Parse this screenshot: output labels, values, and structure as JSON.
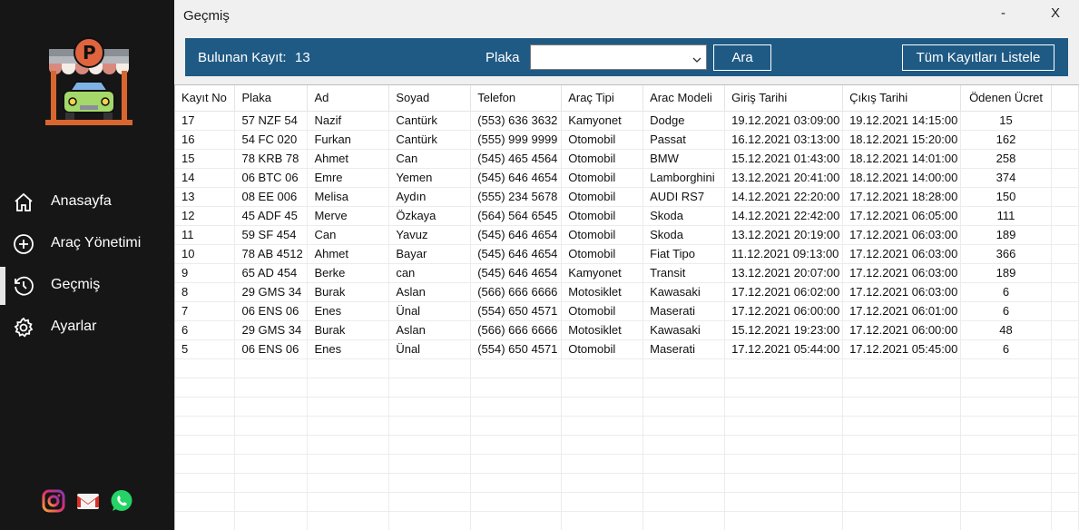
{
  "window": {
    "title": "Geçmiş",
    "minimize_label": "-",
    "close_label": "X"
  },
  "sidebar": {
    "items": [
      {
        "label": "Anasayfa",
        "icon": "home-icon",
        "active": false
      },
      {
        "label": "Araç Yönetimi",
        "icon": "plus-circle-icon",
        "active": false
      },
      {
        "label": "Geçmiş",
        "icon": "history-icon",
        "active": true
      },
      {
        "label": "Ayarlar",
        "icon": "gear-icon",
        "active": false
      }
    ],
    "social": [
      "instagram-icon",
      "gmail-icon",
      "whatsapp-icon"
    ]
  },
  "toolbar": {
    "found_label": "Bulunan Kayıt:",
    "found_value": "13",
    "plaka_label": "Plaka",
    "plaka_value": "",
    "search_label": "Ara",
    "list_all_label": "Tüm Kayıtları Listele"
  },
  "table": {
    "columns": [
      "Kayıt No",
      "Plaka",
      "Ad",
      "Soyad",
      "Telefon",
      "Araç Tipi",
      "Arac Modeli",
      "Giriş Tarihi",
      "Çıkış Tarihi",
      "Ödenen Ücret"
    ],
    "rows": [
      [
        "17",
        "57 NZF 54",
        "Nazif",
        "Cantürk",
        "(553) 636 3632",
        "Kamyonet",
        "Dodge",
        "19.12.2021 03:09:00",
        "19.12.2021 14:15:00",
        "15"
      ],
      [
        "16",
        "54 FC 020",
        "Furkan",
        "Cantürk",
        "(555) 999 9999",
        "Otomobil",
        "Passat",
        "16.12.2021 03:13:00",
        "18.12.2021 15:20:00",
        "162"
      ],
      [
        "15",
        "78 KRB 78",
        "Ahmet",
        "Can",
        "(545) 465 4564",
        "Otomobil",
        "BMW",
        "15.12.2021 01:43:00",
        "18.12.2021 14:01:00",
        "258"
      ],
      [
        "14",
        "06 BTC 06",
        "Emre",
        "Yemen",
        "(545) 646 4654",
        "Otomobil",
        "Lamborghini",
        "13.12.2021 20:41:00",
        "18.12.2021 14:00:00",
        "374"
      ],
      [
        "13",
        "08 EE 006",
        "Melisa",
        "Aydın",
        "(555) 234 5678",
        "Otomobil",
        "AUDI RS7",
        "14.12.2021 22:20:00",
        "17.12.2021 18:28:00",
        "150"
      ],
      [
        "12",
        "45 ADF 45",
        "Merve",
        "Özkaya",
        "(564) 564 6545",
        "Otomobil",
        "Skoda",
        "14.12.2021 22:42:00",
        "17.12.2021 06:05:00",
        "111"
      ],
      [
        "11",
        "59 SF 454",
        "Can",
        "Yavuz",
        "(545) 646 4654",
        "Otomobil",
        "Skoda",
        "13.12.2021 20:19:00",
        "17.12.2021 06:03:00",
        "189"
      ],
      [
        "10",
        "78 AB 4512",
        "Ahmet",
        "Bayar",
        "(545) 646 4654",
        "Otomobil",
        "Fiat Tipo",
        "11.12.2021 09:13:00",
        "17.12.2021 06:03:00",
        "366"
      ],
      [
        "9",
        "65 AD 454",
        "Berke",
        "can",
        "(545) 646 4654",
        "Kamyonet",
        "Transit",
        "13.12.2021 20:07:00",
        "17.12.2021 06:03:00",
        "189"
      ],
      [
        "8",
        "29 GMS 34",
        "Burak",
        "Aslan",
        "(566) 666 6666",
        "Motosiklet",
        "Kawasaki",
        "17.12.2021 06:02:00",
        "17.12.2021 06:03:00",
        "6"
      ],
      [
        "7",
        "06 ENS 06",
        "Enes",
        "Ünal",
        "(554) 650 4571",
        "Otomobil",
        "Maserati",
        "17.12.2021 06:00:00",
        "17.12.2021 06:01:00",
        "6"
      ],
      [
        "6",
        "29 GMS 34",
        "Burak",
        "Aslan",
        "(566) 666 6666",
        "Motosiklet",
        "Kawasaki",
        "15.12.2021 19:23:00",
        "17.12.2021 06:00:00",
        "48"
      ],
      [
        "5",
        "06 ENS 06",
        "Enes",
        "Ünal",
        "(554) 650 4571",
        "Otomobil",
        "Maserati",
        "17.12.2021 05:44:00",
        "17.12.2021 05:45:00",
        "6"
      ]
    ]
  },
  "colors": {
    "sidebar_bg": "#161616",
    "toolbar_bg": "#1f5a85",
    "window_bg": "#f0f0f0"
  }
}
